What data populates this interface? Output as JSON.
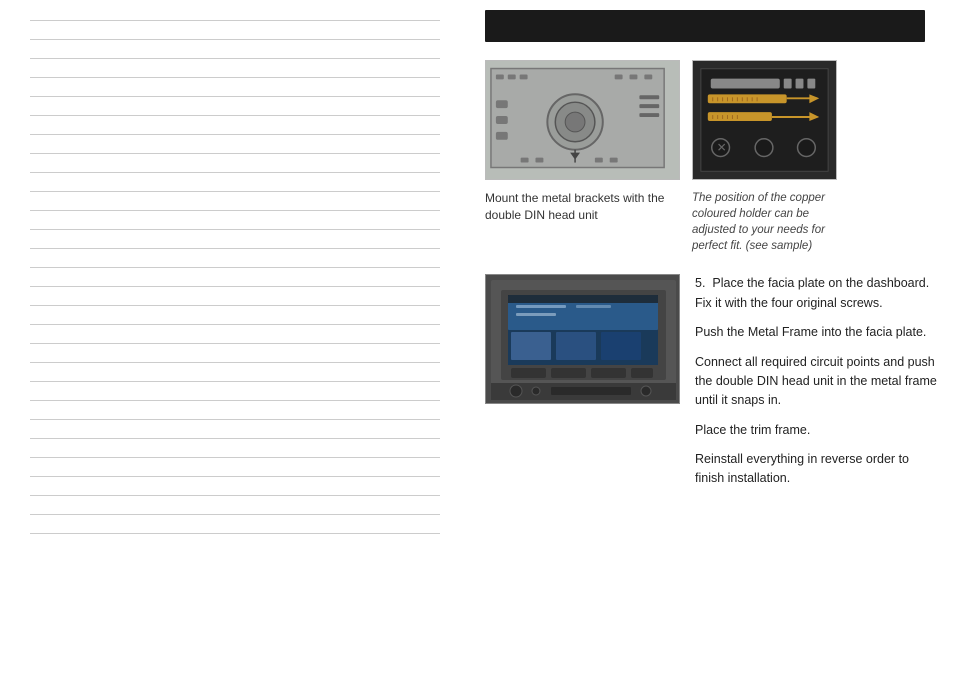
{
  "left": {
    "lines_count": 28
  },
  "header": {
    "bar_label": ""
  },
  "section1": {
    "caption_left": "Mount the metal brackets with the double DIN head unit",
    "caption_right": "The position of the copper coloured holder can be adjusted to your needs for perfect fit. (see sample)"
  },
  "section2": {
    "step_number": "5.",
    "para1": "Place the facia plate on the dashboard. Fix it with the four original screws.",
    "para2": "Push the Metal Frame into the facia plate.",
    "para3": "Connect all required circuit points and push the double DIN head unit in the metal frame until it snaps in.",
    "para4": "Place the trim frame.",
    "para5": "Reinstall everything in  reverse order to finish installation."
  }
}
